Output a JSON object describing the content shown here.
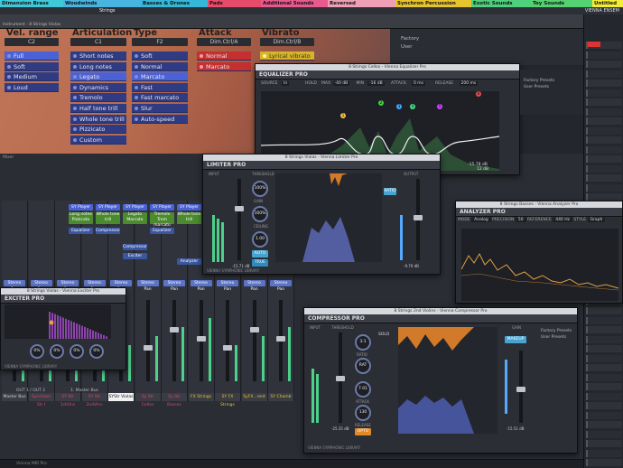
{
  "categories": [
    {
      "label": "Dimension Brass",
      "color": "#3ec8d8"
    },
    {
      "label": "Woodwinds",
      "color": "#48b4e0"
    },
    {
      "label": "Basses & Drones",
      "color": "#35b8d8"
    },
    {
      "label": "Pads",
      "color": "#e84b6a"
    },
    {
      "label": "Additional Sounds",
      "color": "#e8598e"
    },
    {
      "label": "Reversed",
      "color": "#ef9fb5"
    },
    {
      "label": "Synchron Percussion",
      "color": "#e6c42e"
    },
    {
      "label": "Exotic Sounds",
      "color": "#4fd07c"
    },
    {
      "label": "Toy Sounds",
      "color": "#54d272"
    },
    {
      "label": "Untitled",
      "color": "#f2ed36"
    }
  ],
  "track_title": "Strings",
  "vienna_ensemble": "VIENNA ENSEM",
  "instrument": {
    "header_left": "Instrument - 8 Strings Violas",
    "columns": [
      {
        "title": "Vel. range",
        "value": "C2",
        "items": [
          {
            "label": "Full",
            "state": "on"
          },
          {
            "label": "Soft",
            "state": "off"
          },
          {
            "label": "Medium",
            "state": "off"
          },
          {
            "label": "Loud",
            "state": "off"
          }
        ]
      },
      {
        "title": "Articulation",
        "value": "C1",
        "items": [
          {
            "label": "Short notes",
            "state": "off"
          },
          {
            "label": "Long notes",
            "state": "off"
          },
          {
            "label": "Legato",
            "state": "on"
          },
          {
            "label": "Dynamics",
            "state": "off"
          },
          {
            "label": "Tremolo",
            "state": "off"
          },
          {
            "label": "Half tone trill",
            "state": "off"
          },
          {
            "label": "Whole tone trill",
            "state": "off"
          },
          {
            "label": "Pizzicato",
            "state": "off"
          },
          {
            "label": "Custom",
            "state": "off"
          }
        ]
      },
      {
        "title": "Type",
        "value": "F2",
        "items": [
          {
            "label": "Soft",
            "state": "off"
          },
          {
            "label": "Normal",
            "state": "off"
          },
          {
            "label": "Marcato",
            "state": "on"
          },
          {
            "label": "Fast",
            "state": "off"
          },
          {
            "label": "Fast marcato",
            "state": "off"
          },
          {
            "label": "Slur",
            "state": "off"
          },
          {
            "label": "Auto-speed",
            "state": "off"
          }
        ]
      },
      {
        "title": "Attack",
        "value": "Dim.Ctrl/A",
        "items": [
          {
            "label": "Normal",
            "state": "red"
          },
          {
            "label": "Marcato",
            "state": "red"
          }
        ]
      },
      {
        "title": "Vibrato",
        "value": "Dim.Ctrl/B",
        "items": [
          {
            "label": "Lyrical vibrato",
            "state": "yel"
          }
        ]
      }
    ],
    "presets": [
      "Factory",
      "User"
    ]
  },
  "mixer": {
    "label": "Mixer",
    "channels": [
      {
        "name": "Master Bus",
        "color": "#d0d2d8"
      },
      {
        "name": "Synchron Str I",
        "color": "#e8406a"
      },
      {
        "name": "SY Str 1stVlns",
        "color": "#e8406a"
      },
      {
        "name": "SY Str 2ndVlns",
        "color": "#e8406a"
      },
      {
        "name": "SYStr Violas",
        "color": "#e8406a"
      },
      {
        "name": "Sy Str Cellos",
        "color": "#e8406a"
      },
      {
        "name": "Sy Str Basses",
        "color": "#e8406a"
      },
      {
        "name": "FX Strings",
        "color": "#e6c42e"
      },
      {
        "name": "SY FX Strings",
        "color": "#e6c42e"
      },
      {
        "name": "SyFX...rent",
        "color": "#e6c42e"
      },
      {
        "name": "SY Chamb",
        "color": "#e6c42e"
      }
    ],
    "out_label": "OUT 1 / OUT 2",
    "bus_label": "1: Master Bus",
    "insert_slots": [
      "SY Player",
      "SY Player",
      "SY Player",
      "SY Player",
      "SY Player"
    ],
    "slot_labels": [
      "Long notes Pizzicato",
      "Whole tone trill",
      "Legato Marcato",
      "Tremolo Trem marcato",
      "Whole tone trill"
    ],
    "fx": [
      "Equalizer",
      "Compressor",
      "Compressor",
      "Exciter",
      "Equalizer",
      "Analyzer"
    ],
    "pan": "Stereo Pan"
  },
  "equalizer": {
    "window_title": "8 Strings Cellos - Vienna Equalizer Pro",
    "name": "EQUALIZER PRO",
    "source": "SOURCE",
    "in": "In",
    "hold": "HOLD",
    "max": "MAX",
    "max_val": "-40 dB",
    "min": "MIN",
    "min_val": "-16 dB",
    "attack": "ATTACK",
    "attack_val": "0 ms",
    "release": "RELEASE",
    "release_val": "200 ms",
    "presets": [
      "Factory Presets",
      "User Presets"
    ],
    "bands": [
      {
        "n": "1",
        "color": "#f0c040"
      },
      {
        "n": "2",
        "color": "#44cc44"
      },
      {
        "n": "3",
        "color": "#3fa8ff"
      },
      {
        "n": "4",
        "color": "#44dd88"
      },
      {
        "n": "5",
        "color": "#cc44ff"
      },
      {
        "n": "6",
        "color": "#e84c4c"
      }
    ],
    "readout1": "-15.78 dB",
    "readout2": "12 dB",
    "readout3": "0 dB",
    "readout4": "-24 dB"
  },
  "limiter": {
    "window_title": "8 Strings Violas - Vienna Limiter Pro",
    "name": "LIMITER PRO",
    "threshold": "THRESHOLD",
    "input": "INPUT",
    "output": "OUTPUT",
    "k1": "100%",
    "k2": "100%",
    "k3": "1.00",
    "ratio": "RATIO",
    "gain": "GAIN",
    "group": "GROUP",
    "ceiling": "CEILING",
    "release": "RELEASE",
    "auto": "AUTO",
    "true": "TRUE",
    "val": "-15.71 dB",
    "out": "-9.79 dB",
    "footer": "VIENNA SYMPHONIC LIBRARY"
  },
  "analyzer": {
    "window_title": "8 Strings Basses - Vienna Analyzer Pro",
    "name": "ANALYZER PRO",
    "mode": "MODE",
    "mode_val": "Analog",
    "precision": "PRECISION",
    "precision_val": "50",
    "reference": "REFERENCE",
    "ref_val": "440 Hz",
    "style": "STYLE",
    "style_val": "Graph"
  },
  "exciter": {
    "window_title": "8 Strings Violas - Vienna Exciter Pro",
    "name": "EXCITER PRO",
    "knobs": [
      "0%",
      "0%",
      "0%",
      "0%"
    ],
    "footer": "VIENNA SYMPHONIC LIBRARY"
  },
  "compressor": {
    "window_title": "8 Strings 2nd Violins - Vienna Compressor Pro",
    "name": "COMPRESSOR PRO",
    "input": "INPUT",
    "threshold": "THRESHOLD",
    "knee": "KNEE",
    "ratio": "RATIO",
    "attack": "ATTACK",
    "release": "RELEASE",
    "gain": "GAIN",
    "solo": "SOLO",
    "ratio_val": "3:1",
    "ratio2": "4.1",
    "knee_val": "RAT",
    "att_val": "7.01",
    "rel_val": "130",
    "sidechain": "SIDECHAIN",
    "makeup": "MAKEUP",
    "auto": "AUTO",
    "opto": "OPTO",
    "val1": "-25.35 dB",
    "val2": "-15.51 dB",
    "presets": [
      "Factory Presets",
      "User Presets"
    ],
    "footer": "VIENNA SYMPHONIC LIBRARY"
  },
  "status": "Vienna MIR Pro"
}
